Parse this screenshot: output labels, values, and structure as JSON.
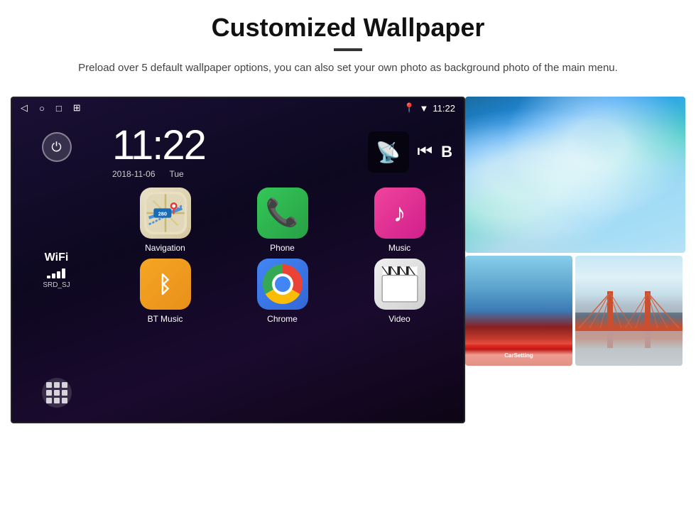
{
  "page": {
    "title": "Customized Wallpaper",
    "title_divider": true,
    "subtitle": "Preload over 5 default wallpaper options, you can also set your own photo as background photo of the main menu."
  },
  "android": {
    "status_bar": {
      "time": "11:22",
      "nav_icons": [
        "◁",
        "○",
        "□",
        "⊞"
      ],
      "right_icons": [
        "location",
        "wifi",
        "time"
      ]
    },
    "clock": {
      "time": "11:22",
      "date": "2018-11-06",
      "day": "Tue"
    },
    "wifi": {
      "label": "WiFi",
      "ssid": "SRD_SJ"
    },
    "apps": [
      {
        "label": "Navigation",
        "type": "navigation"
      },
      {
        "label": "Phone",
        "type": "phone"
      },
      {
        "label": "Music",
        "type": "music"
      },
      {
        "label": "BT Music",
        "type": "bt"
      },
      {
        "label": "Chrome",
        "type": "chrome"
      },
      {
        "label": "Video",
        "type": "video"
      }
    ],
    "wallpaper_labels": [
      "CarSetting"
    ]
  }
}
